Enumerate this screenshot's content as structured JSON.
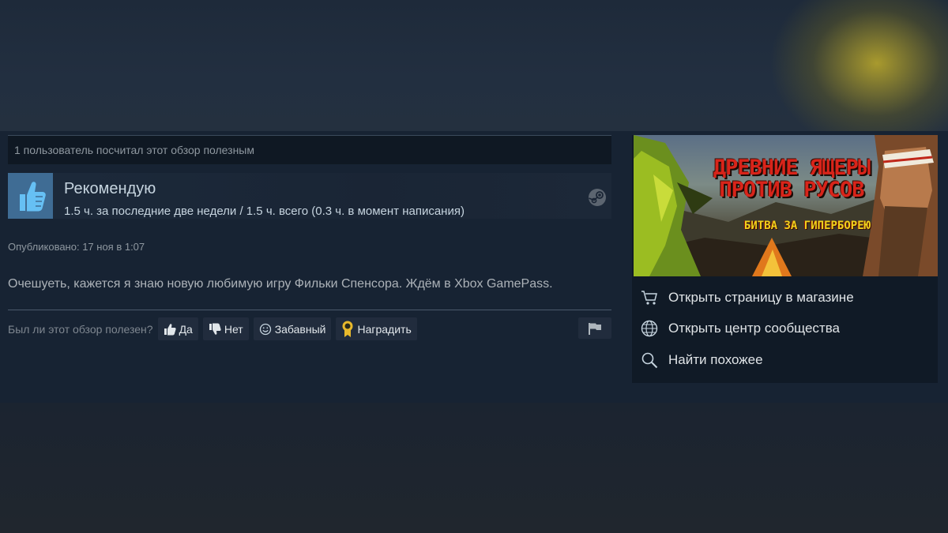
{
  "review": {
    "helpful_count_text": "1 пользователь посчитал этот обзор полезным",
    "recommendation": "Рекомендую",
    "hours_text": "1.5 ч. за последние две недели / 1.5 ч. всего (0.3 ч. в момент написания)",
    "posted_text": "Опубликовано: 17 ноя в 1:07",
    "body_text": "Очешуеть, кажется я знаю новую любимую игру Фильки Спенсора. Ждём в Xbox GamePass."
  },
  "voting": {
    "question": "Был ли этот обзор полезен?",
    "yes_label": "Да",
    "no_label": "Нет",
    "funny_label": "Забавный",
    "award_label": "Наградить"
  },
  "game": {
    "title_line1": "ДРЕВНИЕ ЯЩЕРЫ",
    "title_line2": "ПРОТИВ РУСОВ",
    "subtitle": "БИТВА ЗА ГИПЕРБОРЕЮ"
  },
  "sidebar": {
    "links": [
      {
        "label": "Открыть страницу в магазине",
        "icon": "cart-icon"
      },
      {
        "label": "Открыть центр сообщества",
        "icon": "globe-icon"
      },
      {
        "label": "Найти похожее",
        "icon": "search-icon"
      }
    ]
  },
  "colors": {
    "background": "#1b2838",
    "panel": "#172333",
    "thumb_box": "#3f6c94",
    "text_primary": "#c6d4df",
    "text_muted": "#8f98a0",
    "button_bg": "#212c3d",
    "award_gold": "#e8b92c"
  }
}
